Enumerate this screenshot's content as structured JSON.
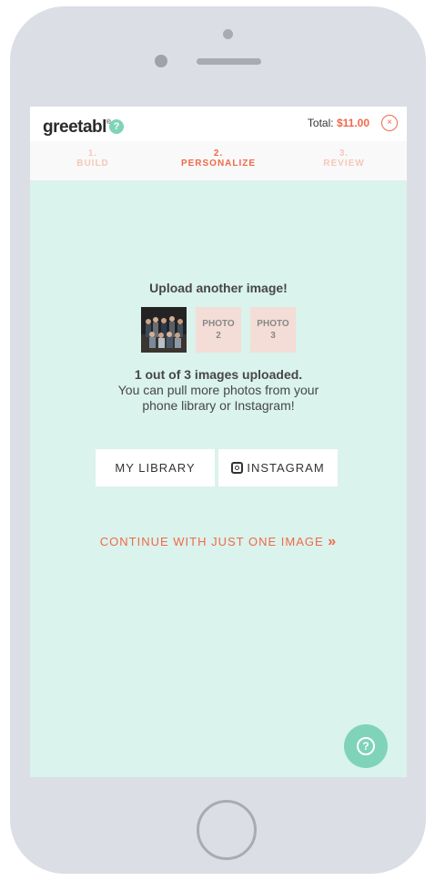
{
  "brand": {
    "logo_text": "greetabl",
    "trademark": "®",
    "help_badge": "?"
  },
  "header": {
    "total_label": "Total:",
    "total_amount": "$11.00",
    "close_symbol": "×"
  },
  "steps": [
    {
      "number": "1.",
      "label": "BUILD",
      "active": false
    },
    {
      "number": "2.",
      "label": "PERSONALIZE",
      "active": true
    },
    {
      "number": "3.",
      "label": "REVIEW",
      "active": false
    }
  ],
  "upload": {
    "heading": "Upload another image!",
    "slots": [
      {
        "label": "",
        "filled": true
      },
      {
        "label_line1": "PHOTO",
        "label_line2": "2",
        "filled": false
      },
      {
        "label_line1": "PHOTO",
        "label_line2": "3",
        "filled": false
      }
    ],
    "status_bold": "1 out of 3 images uploaded.",
    "status_text_line1": "You can pull more photos from your",
    "status_text_line2": "phone library or Instagram!"
  },
  "buttons": {
    "library": "MY LIBRARY",
    "instagram": "INSTAGRAM",
    "instagram_icon": "instagram-icon"
  },
  "continue": {
    "label": "CONTINUE WITH JUST ONE IMAGE",
    "arrow": "»"
  },
  "help_fab": {
    "icon": "question-icon",
    "symbol": "?"
  },
  "colors": {
    "accent": "#f0694a",
    "mint": "#7fd3b9",
    "screen_bg": "#daf3ec",
    "phone_body": "#dcdee6"
  }
}
